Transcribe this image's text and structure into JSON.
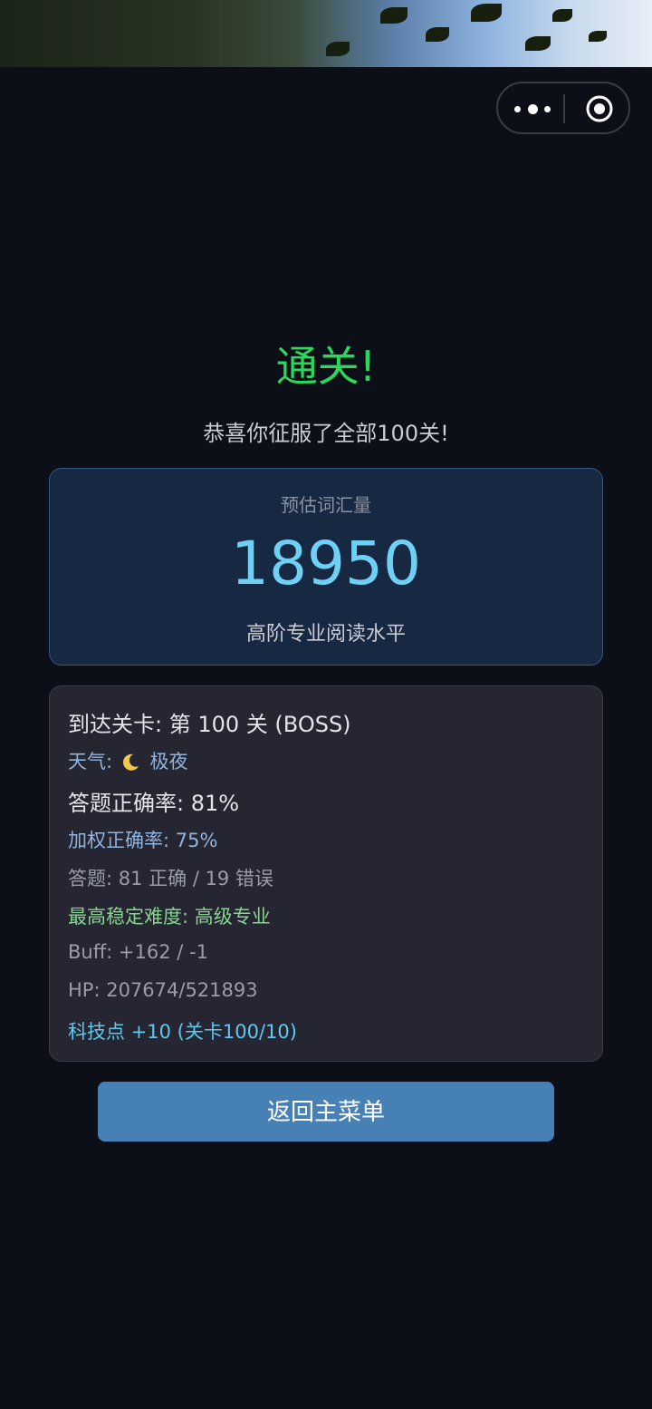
{
  "capsule": {
    "more_icon": "more-dots-icon",
    "close_icon": "target-circle-icon"
  },
  "result": {
    "title": "通关!",
    "subtitle": "恭喜你征服了全部100关!"
  },
  "vocab": {
    "label": "预估词汇量",
    "value": "18950",
    "level": "高阶专业阅读水平"
  },
  "stats": {
    "stage": "到达关卡: 第 100 关 (BOSS)",
    "weather_prefix": "天气:",
    "weather_icon": "moon-icon",
    "weather_value": "极夜",
    "accuracy": "答题正确率: 81%",
    "weighted_accuracy": "加权正确率: 75%",
    "answers": "答题: 81 正确 / 19 错误",
    "max_difficulty": "最高稳定难度: 高级专业",
    "buff": "Buff: +162 / -1",
    "hp": "HP: 207674/521893",
    "tech_points": "科技点 +10 (关卡100/10)"
  },
  "actions": {
    "back_label": "返回主菜单"
  },
  "colors": {
    "background": "#0d0f18",
    "title_green": "#2bd95a",
    "vocab_blue": "#6fd0f5",
    "button_blue": "#4780b4"
  }
}
